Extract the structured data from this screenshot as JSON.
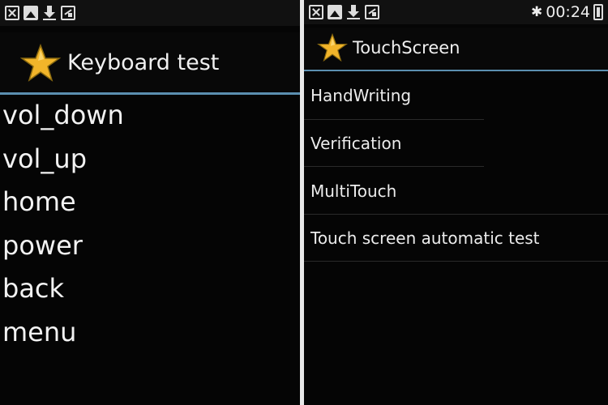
{
  "left_screen": {
    "status_icons": [
      "close-notification-icon",
      "image-icon",
      "download-icon",
      "picture-icon"
    ],
    "title": "Keyboard test",
    "title_icon": "star-icon",
    "items": [
      "vol_down",
      "vol_up",
      "home",
      "power",
      "back",
      "menu"
    ]
  },
  "right_screen": {
    "status_icons": [
      "close-notification-icon",
      "image-icon",
      "download-icon",
      "picture-icon"
    ],
    "status_right": {
      "bluetooth_icon": "bluetooth-icon",
      "time": "00:24",
      "battery_icon": "battery-icon"
    },
    "title": "TouchScreen",
    "title_icon": "star-icon",
    "items": [
      "HandWriting",
      "Verification",
      "MultiTouch",
      "Touch screen automatic test"
    ]
  },
  "colors": {
    "accent_line": "#5b8fb0",
    "star_fill": "#f2b52a",
    "background": "#000000"
  }
}
